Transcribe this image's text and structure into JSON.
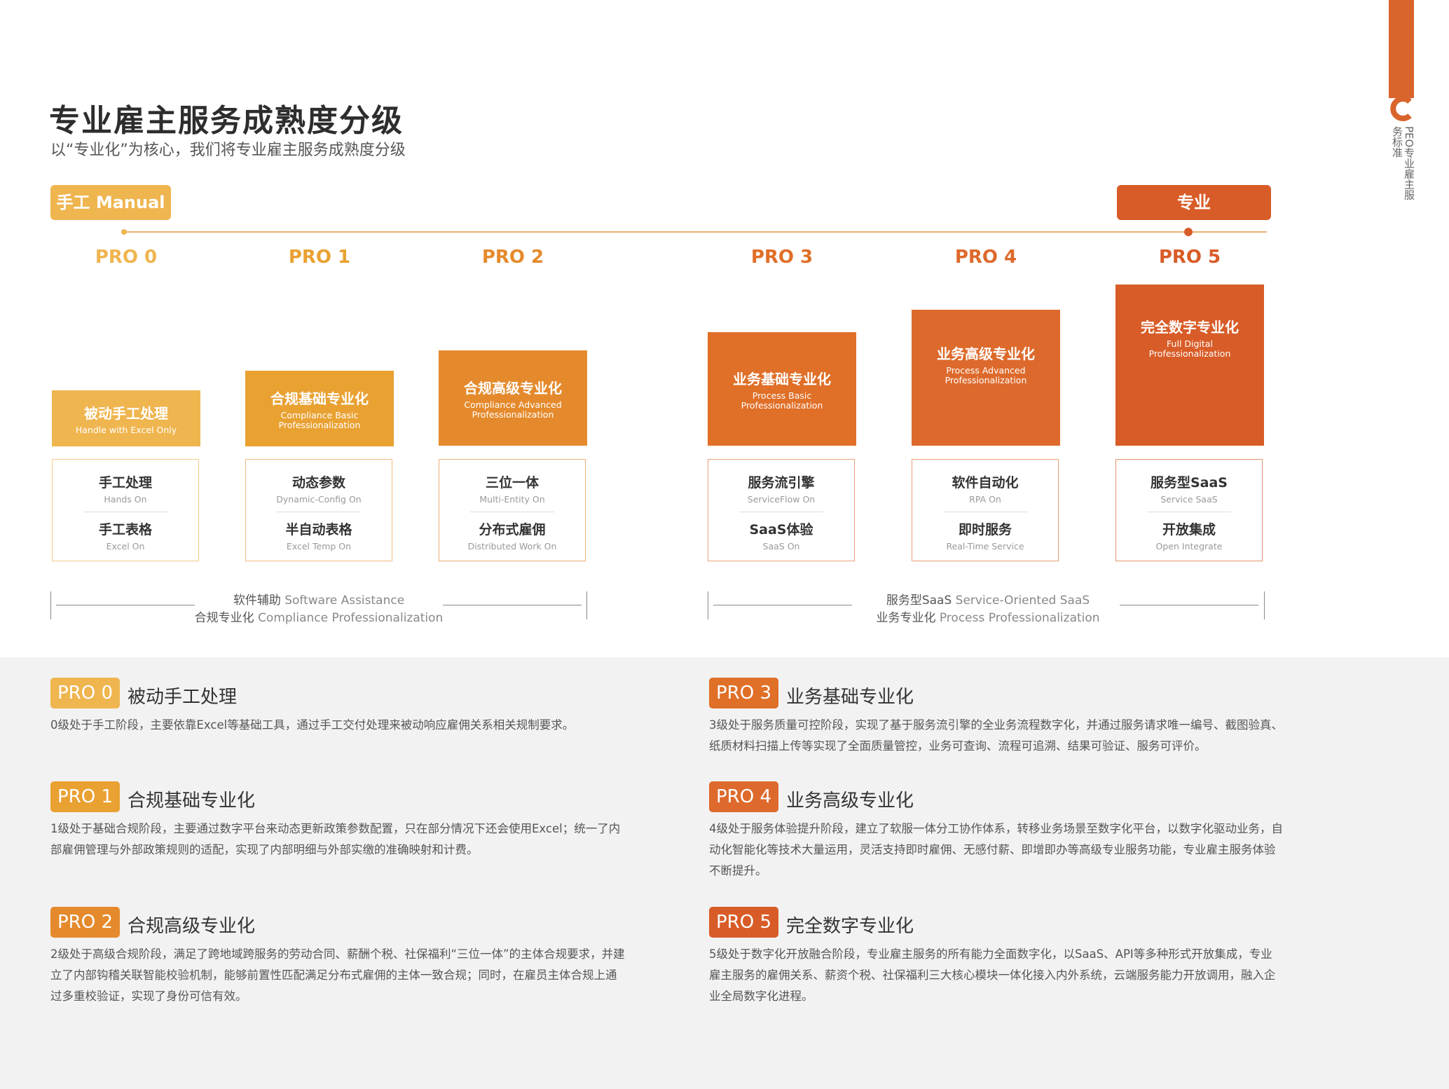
{
  "sidebar": {
    "vertical_text": "PEO专业雇主服务标准"
  },
  "header": {
    "title": "专业雇主服务成熟度分级",
    "subtitle": "以“专业化”为核心，我们将专业雇主服务成熟度分级"
  },
  "tags": {
    "manual": "手工 Manual",
    "professional": "专业 Professional"
  },
  "colors": {
    "pro0": "#efb54f",
    "pro1": "#e9a132",
    "pro2": "#e58a2c",
    "pro3": "#e06f27",
    "pro4": "#dd6a2c",
    "pro5": "#d85c27",
    "grey_bg": "#f2f2f2"
  },
  "levels": [
    {
      "label": "PRO 0",
      "cn": "被动手工处理",
      "en": "Handle with Excel Only",
      "f1_cn": "手工处理",
      "f1_en": "Hands On",
      "f2_cn": "手工表格",
      "f2_en": "Excel On"
    },
    {
      "label": "PRO 1",
      "cn": "合规基础专业化",
      "en": "Compliance Basic Professionalization",
      "f1_cn": "动态参数",
      "f1_en": "Dynamic-Config On",
      "f2_cn": "半自动表格",
      "f2_en": "Excel Temp On"
    },
    {
      "label": "PRO 2",
      "cn": "合规高级专业化",
      "en": "Compliance Advanced Professionalization",
      "f1_cn": "三位一体",
      "f1_en": "Multi-Entity On",
      "f2_cn": "分布式雇佣",
      "f2_en": "Distributed Work On"
    },
    {
      "label": "PRO 3",
      "cn": "业务基础专业化",
      "en": "Process Basic Professionalization",
      "f1_cn": "服务流引擎",
      "f1_en": "ServiceFlow  On",
      "f2_cn": "SaaS体验",
      "f2_en": "SaaS On"
    },
    {
      "label": "PRO 4",
      "cn": "业务高级专业化",
      "en": "Process Advanced Professionalization",
      "f1_cn": "软件自动化",
      "f1_en": "RPA On",
      "f2_cn": "即时服务",
      "f2_en": "Real-Time Service"
    },
    {
      "label": "PRO 5",
      "cn": "完全数字专业化",
      "en": "Full Digital Professionalization",
      "f1_cn": "服务型SaaS",
      "f1_en": "Service SaaS",
      "f2_cn": "开放集成",
      "f2_en": "Open Integrate"
    }
  ],
  "brackets": {
    "left": {
      "l1_cn": "软件辅助",
      "l1_en": "Software Assistance",
      "l2_cn": "合规专业化",
      "l2_en": "Compliance Professionalization"
    },
    "right": {
      "l1_cn": "服务型SaaS",
      "l1_en": "Service-Oriented SaaS",
      "l2_cn": "业务专业化",
      "l2_en": "Process Professionalization"
    }
  },
  "descriptions": [
    {
      "badge": "PRO 0",
      "title": "被动手工处理",
      "body": "0级处于手工阶段，主要依靠Excel等基础工具，通过手工交付处理来被动响应雇佣关系相关规制要求。"
    },
    {
      "badge": "PRO 1",
      "title": "合规基础专业化",
      "body": "1级处于基础合规阶段，主要通过数字平台来动态更新政策参数配置，只在部分情况下还会使用Excel；统一了内部雇佣管理与外部政策规则的适配，实现了内部明细与外部实缴的准确映射和计费。"
    },
    {
      "badge": "PRO 2",
      "title": "合规高级专业化",
      "body": "2级处于高级合规阶段，满足了跨地域跨服务的劳动合同、薪酬个税、社保福利“三位一体”的主体合规要求，并建立了内部钩稽关联智能校验机制，能够前置性匹配满足分布式雇佣的主体一致合规；同时，在雇员主体合规上通过多重校验证，实现了身份可信有效。"
    },
    {
      "badge": "PRO 3",
      "title": "业务基础专业化",
      "body": "3级处于服务质量可控阶段，实现了基于服务流引擎的全业务流程数字化，并通过服务请求唯一编号、截图验真、纸质材料扫描上传等实现了全面质量管控，业务可查询、流程可追溯、结果可验证、服务可评价。"
    },
    {
      "badge": "PRO 4",
      "title": "业务高级专业化",
      "body": "4级处于服务体验提升阶段，建立了软服一体分工协作体系，转移业务场景至数字化平台，以数字化驱动业务，自动化智能化等技术大量运用，灵活支持即时雇佣、无感付薪、即增即办等高级专业服务功能，专业雇主服务体验不断提升。"
    },
    {
      "badge": "PRO 5",
      "title": "完全数字专业化",
      "body": "5级处于数字化开放融合阶段，专业雇主服务的所有能力全面数字化，以SaaS、API等多种形式开放集成，专业雇主服务的雇佣关系、薪资个税、社保福利三大核心模块一体化接入内外系统，云端服务能力开放调用，融入企业全局数字化进程。"
    }
  ]
}
